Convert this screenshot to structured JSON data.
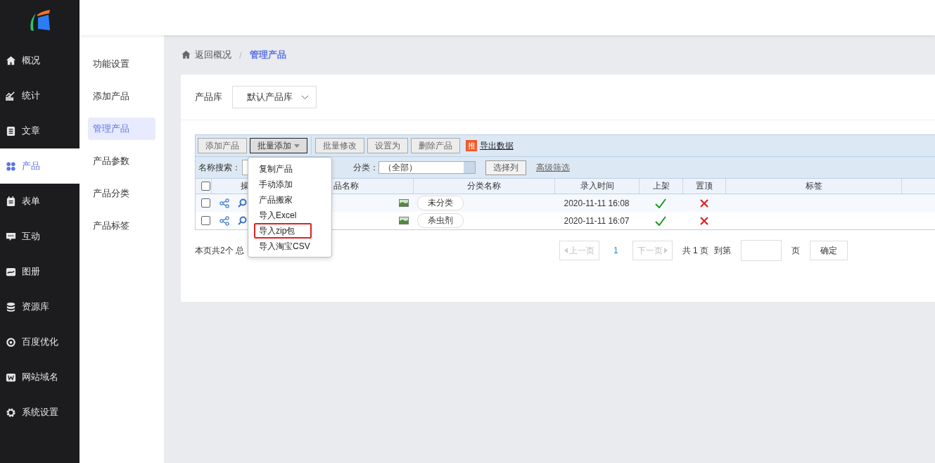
{
  "sidebar": {
    "items": [
      {
        "label": "概况",
        "selected": false
      },
      {
        "label": "统计",
        "selected": false
      },
      {
        "label": "文章",
        "selected": false
      },
      {
        "label": "产品",
        "selected": true
      },
      {
        "label": "表单",
        "selected": false
      },
      {
        "label": "互动",
        "selected": false
      },
      {
        "label": "图册",
        "selected": false
      },
      {
        "label": "资源库",
        "selected": false
      },
      {
        "label": "百度优化",
        "selected": false
      },
      {
        "label": "网站域名",
        "selected": false
      },
      {
        "label": "系统设置",
        "selected": false
      }
    ]
  },
  "submenu": [
    {
      "label": "功能设置",
      "selected": false
    },
    {
      "label": "添加产品",
      "selected": false
    },
    {
      "label": "管理产品",
      "selected": true
    },
    {
      "label": "产品参数",
      "selected": false
    },
    {
      "label": "产品分类",
      "selected": false
    },
    {
      "label": "产品标签",
      "selected": false
    }
  ],
  "breadcrumb": {
    "back": "返回概况",
    "separator": "/",
    "current": "管理产品"
  },
  "library": {
    "label": "产品库",
    "value": "默认产品库"
  },
  "toolbar": {
    "buttons": [
      {
        "label": "添加产品",
        "open": false,
        "kind": "button"
      },
      {
        "label": "批量添加",
        "open": true,
        "kind": "dropdown"
      },
      {
        "label": "批量修改",
        "open": false,
        "kind": "button"
      },
      {
        "label": "设置为",
        "open": false,
        "kind": "button"
      },
      {
        "label": "删除产品",
        "open": false,
        "kind": "button"
      }
    ],
    "badge": "推",
    "export_link": "导出数据"
  },
  "filter": {
    "name_label": "名称搜索：",
    "category_label": "分类：",
    "category_value": "（全部）",
    "columns_button": "选择列",
    "advanced_link": "高级筛选"
  },
  "dropdown": [
    {
      "label": "复制产品",
      "highlighted": false
    },
    {
      "label": "手动添加",
      "highlighted": false
    },
    {
      "label": "产品搬家",
      "highlighted": false
    },
    {
      "label": "导入Excel",
      "highlighted": false
    },
    {
      "label": "导入zip包",
      "highlighted": true
    },
    {
      "label": "导入淘宝CSV",
      "highlighted": false
    }
  ],
  "table": {
    "select_all_checked": false,
    "columns": [
      "操",
      "品名称",
      "分类名称",
      "录入时间",
      "上架",
      "置顶",
      "标签"
    ],
    "rows": [
      {
        "checked": false,
        "category": "未分类",
        "time": "2020-11-11 16:08",
        "listed": true,
        "pinned": false
      },
      {
        "checked": false,
        "category": "杀虫剂",
        "time": "2020-11-11 16:07",
        "listed": true,
        "pinned": false
      }
    ]
  },
  "footer": {
    "summary": "本页共2个 总",
    "prev": "上一页",
    "page": "1",
    "next": "下一页",
    "total": "共 1 页",
    "goto": "到第",
    "page_unit": "页",
    "confirm": "确定"
  }
}
